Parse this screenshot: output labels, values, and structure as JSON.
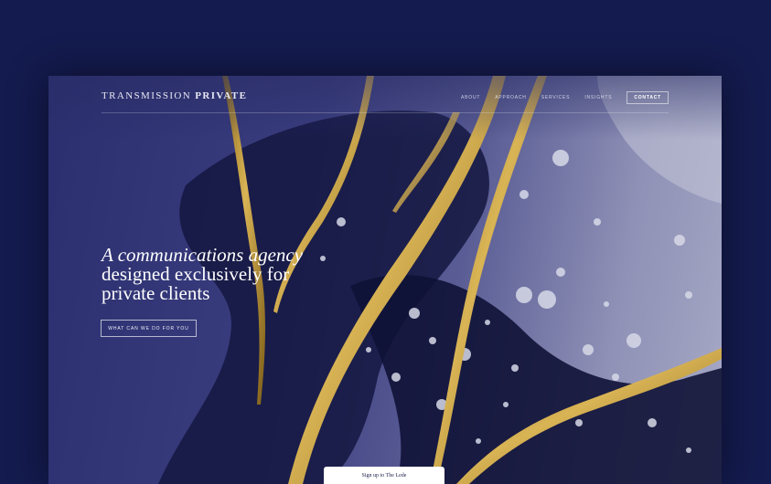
{
  "brand": {
    "name_light": "TRANSMISSION",
    "name_bold": "PRIVATE"
  },
  "nav": {
    "items": [
      "ABOUT",
      "APPROACH",
      "SERVICES",
      "INSIGHTS"
    ],
    "contact": "CONTACT"
  },
  "hero": {
    "headline_line1": "A communications agency",
    "headline_line2": "designed exclusively for",
    "headline_line3": "private clients",
    "cta": "WHAT CAN WE DO FOR YOU"
  },
  "signup": {
    "label": "Sign up to The Lede"
  },
  "colors": {
    "page_bg": "#141b4e",
    "gold": "#c9a13e",
    "navy": "#1a1d52"
  }
}
